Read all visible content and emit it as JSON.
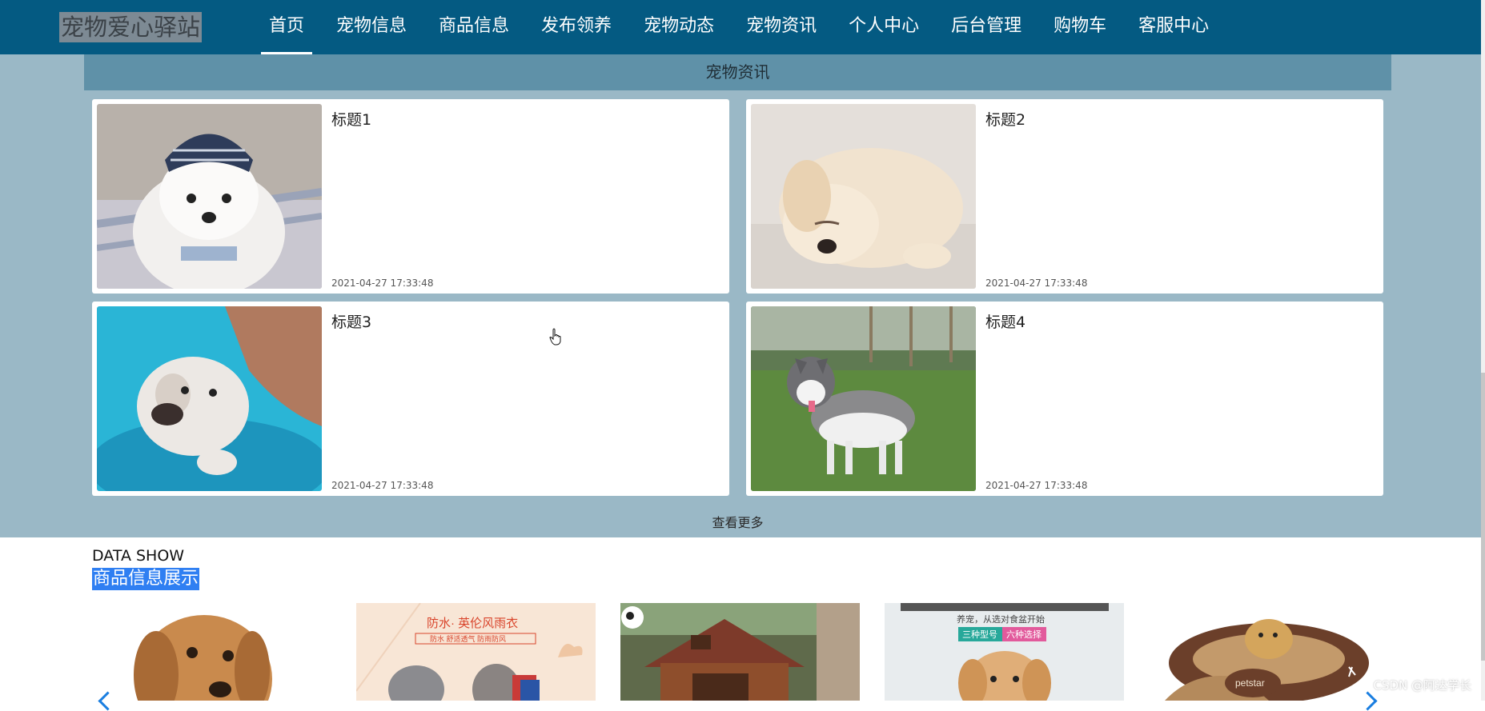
{
  "header": {
    "logo": "宠物爱心驿站",
    "nav": [
      {
        "label": "首页",
        "active": true
      },
      {
        "label": "宠物信息"
      },
      {
        "label": "商品信息"
      },
      {
        "label": "发布领养"
      },
      {
        "label": "宠物动态"
      },
      {
        "label": "宠物资讯"
      },
      {
        "label": "个人中心"
      },
      {
        "label": "后台管理"
      },
      {
        "label": "购物车"
      },
      {
        "label": "客服中心"
      }
    ]
  },
  "news": {
    "section_title": "宠物资讯",
    "items": [
      {
        "title": "标题1",
        "date": "2021-04-27 17:33:48",
        "image": "white-poodle-with-cap"
      },
      {
        "title": "标题2",
        "date": "2021-04-27 17:33:48",
        "image": "sleeping-golden-puppy"
      },
      {
        "title": "标题3",
        "date": "2021-04-27 17:33:48",
        "image": "puppy-in-blue-basin"
      },
      {
        "title": "标题4",
        "date": "2021-04-27 17:33:48",
        "image": "husky-on-grass"
      }
    ],
    "more": "查看更多"
  },
  "data_show": {
    "heading_en": "DATA SHOW",
    "heading_cn": "商品信息展示",
    "products": [
      {
        "image": "beagle-puppy",
        "text": ""
      },
      {
        "image": "dog-raincoat-ad",
        "text": "防水· 英伦风雨衣",
        "subtext": "防水 舒适透气 防雨防风"
      },
      {
        "image": "wooden-dog-house",
        "text": ""
      },
      {
        "image": "dog-food-ad",
        "text": "养宠，从选对食盆开始",
        "tag1": "三种型号",
        "tag2": "六种选择"
      },
      {
        "image": "dog-bed-petstar",
        "text": "petstar"
      }
    ]
  },
  "watermark": "CSDN @阿达学长",
  "colors": {
    "nav_bg": "#045a82",
    "section_bg": "#9ab8c6",
    "section_head_bg": "#5f91a8",
    "highlight": "#2f7ff2"
  }
}
